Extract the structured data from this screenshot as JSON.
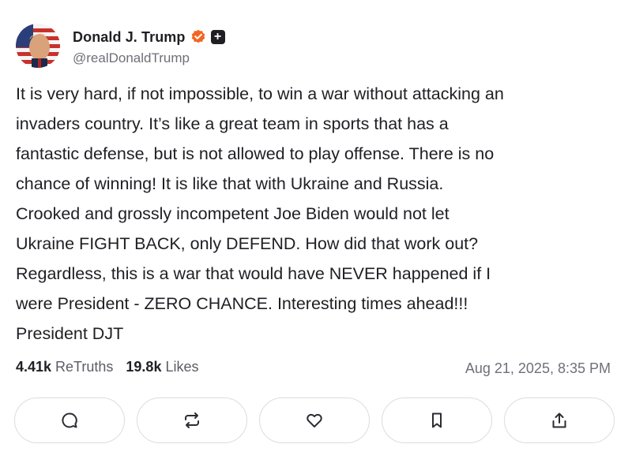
{
  "author": {
    "display_name": "Donald J. Trump",
    "handle": "@realDonaldTrump",
    "avatar_icon": "profile-photo-flag",
    "verified_icon": "verified-check-icon",
    "plus_badge": "+"
  },
  "post": {
    "text": "It is very hard, if not impossible, to win a war without attacking an\ninvaders country. It’s like a great team in sports that has a\nfantastic defense, but is not allowed to play offense. There is no\nchance of winning! It is like that with Ukraine and Russia.\nCrooked and grossly incompetent Joe Biden would not let\nUkraine FIGHT BACK, only DEFEND. How did that work out?\nRegardless, this is a war that would have NEVER happened if I\nwere President - ZERO CHANCE. Interesting times ahead!!!\nPresident DJT"
  },
  "stats": {
    "retruths_count": "4.41k",
    "retruths_label": "ReTruths",
    "likes_count": "19.8k",
    "likes_label": "Likes",
    "timestamp": "Aug 21, 2025, 8:35 PM"
  },
  "actions": [
    {
      "name": "reply",
      "icon": "comment-icon"
    },
    {
      "name": "retruth",
      "icon": "repost-icon"
    },
    {
      "name": "like",
      "icon": "heart-icon"
    },
    {
      "name": "bookmark",
      "icon": "bookmark-icon"
    },
    {
      "name": "share",
      "icon": "share-icon"
    }
  ],
  "colors": {
    "text": "#1f1f24",
    "muted": "#6f6f7a",
    "verified_badge": "#f26522",
    "button_border": "#dcdce3"
  }
}
